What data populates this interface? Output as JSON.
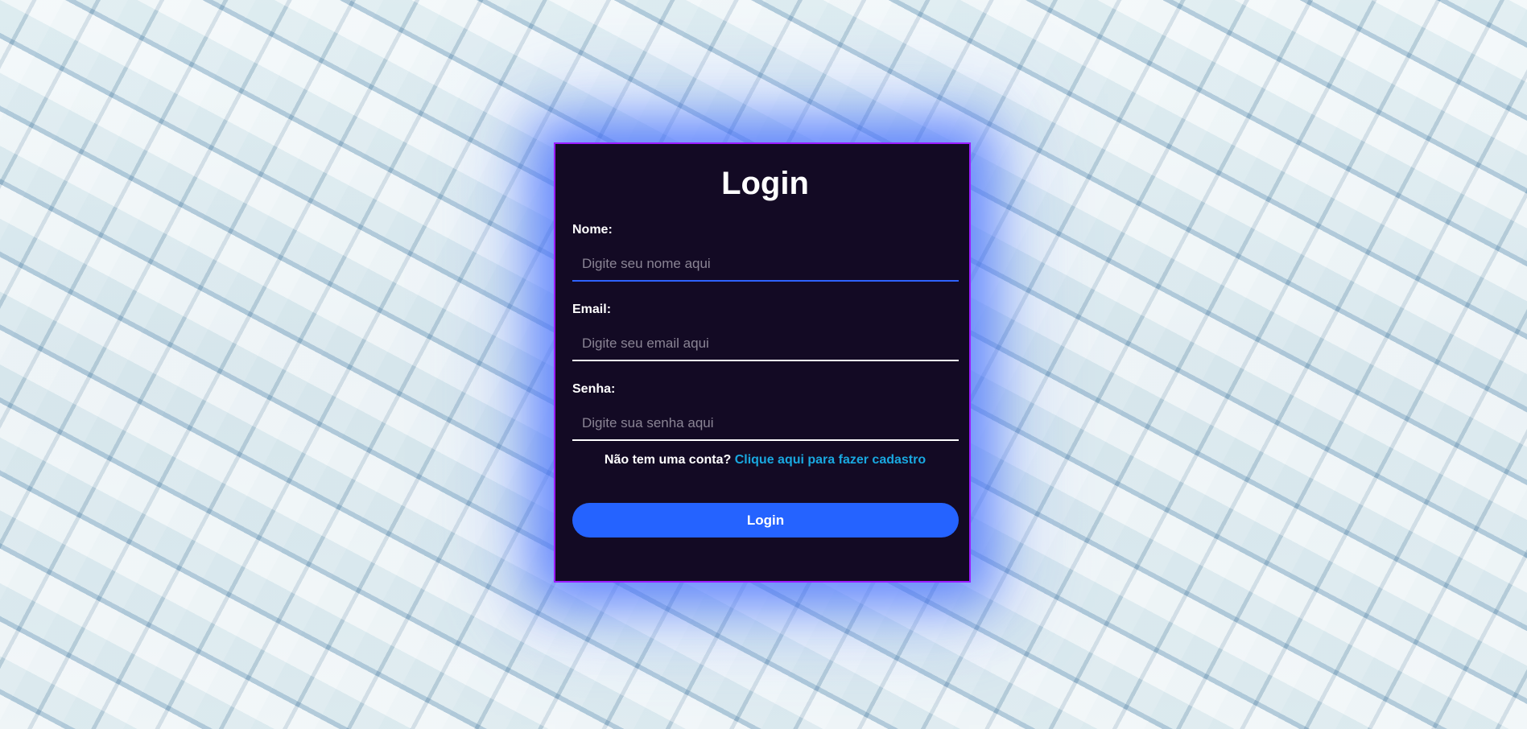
{
  "form": {
    "title": "Login",
    "fields": [
      {
        "label": "Nome:",
        "placeholder": "Digite seu nome aqui",
        "value": ""
      },
      {
        "label": "Email:",
        "placeholder": "Digite seu email aqui",
        "value": ""
      },
      {
        "label": "Senha:",
        "placeholder": "Digite sua senha aqui",
        "value": ""
      }
    ],
    "signup_prompt": "Não tem uma conta?",
    "signup_link": "Clique aqui para fazer cadastro",
    "submit_label": "Login"
  },
  "colors": {
    "card_background": "#130a24",
    "card_border": "#9b1cff",
    "card_glow": "#466eff",
    "button": "#2563ff",
    "link": "#19a8e0",
    "focus_underline": "#2f63ff"
  }
}
